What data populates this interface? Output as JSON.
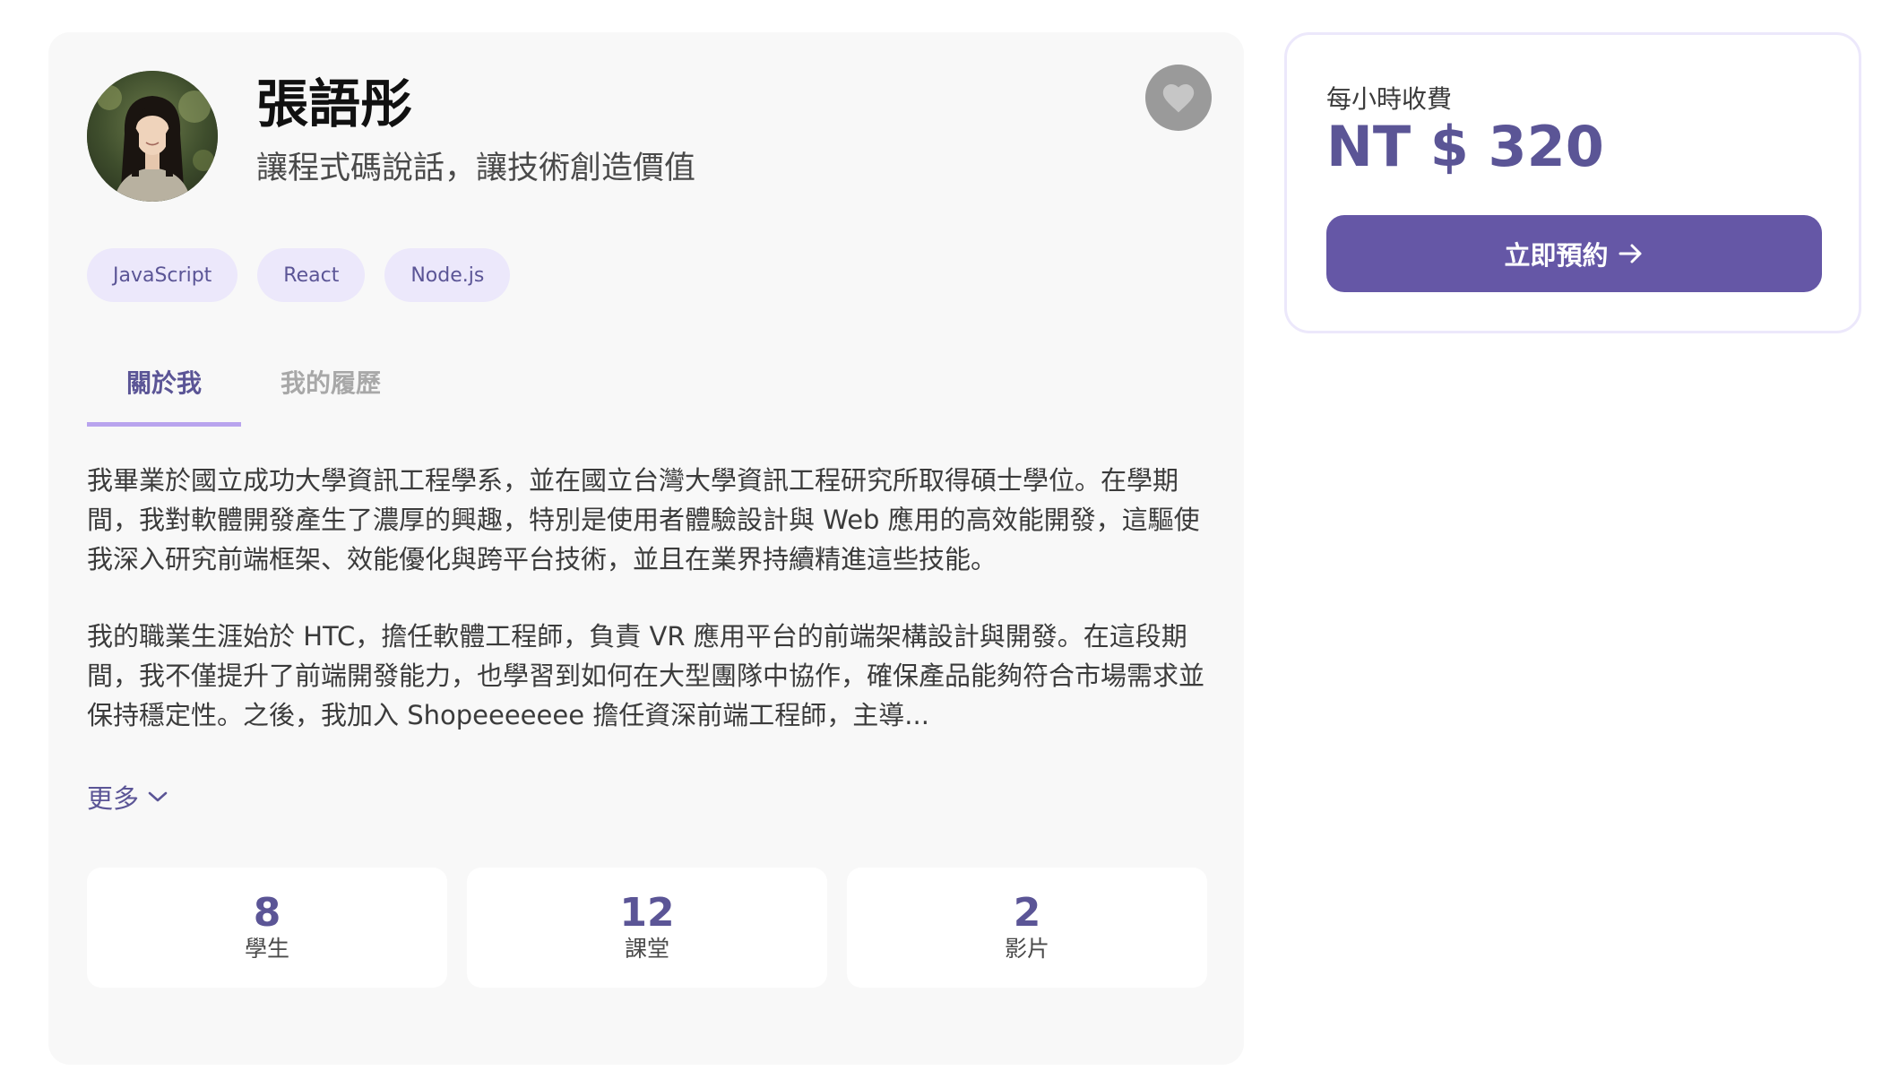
{
  "profile": {
    "name": "張語彤",
    "tagline": "讓程式碼說話，讓技術創造價值",
    "avatar_icon": "person-photo",
    "favorite_icon": "heart-icon"
  },
  "tags": [
    "JavaScript",
    "React",
    "Node.js"
  ],
  "tabs": [
    {
      "label": "關於我",
      "active": true
    },
    {
      "label": "我的履歷",
      "active": false
    }
  ],
  "about": {
    "paragraphs": [
      "我畢業於國立成功大學資訊工程學系，並在國立台灣大學資訊工程研究所取得碩士學位。在學期間，我對軟體開發產生了濃厚的興趣，特別是使用者體驗設計與 Web 應用的高效能開發，這驅使我深入研究前端框架、效能優化與跨平台技術，並且在業界持續精進這些技能。",
      "我的職業生涯始於 HTC，擔任軟體工程師，負責 VR 應用平台的前端架構設計與開發。在這段期間，我不僅提升了前端開發能力，也學習到如何在大型團隊中協作，確保產品能夠符合市場需求並保持穩定性。之後，我加入 Shopeeeeeee 擔任資深前端工程師，主導..."
    ],
    "more_label": "更多"
  },
  "stats": [
    {
      "value": "8",
      "label": "學生"
    },
    {
      "value": "12",
      "label": "課堂"
    },
    {
      "value": "2",
      "label": "影片"
    }
  ],
  "pricing": {
    "label": "每小時收費",
    "value": "NT $ 320",
    "book_label": "立即預約"
  },
  "colors": {
    "accent": "#5b5596",
    "button": "#6557a6",
    "tag_bg": "#ece8fb",
    "tab_underline": "#b9a4ee",
    "card_bg": "#f8f8f8"
  }
}
